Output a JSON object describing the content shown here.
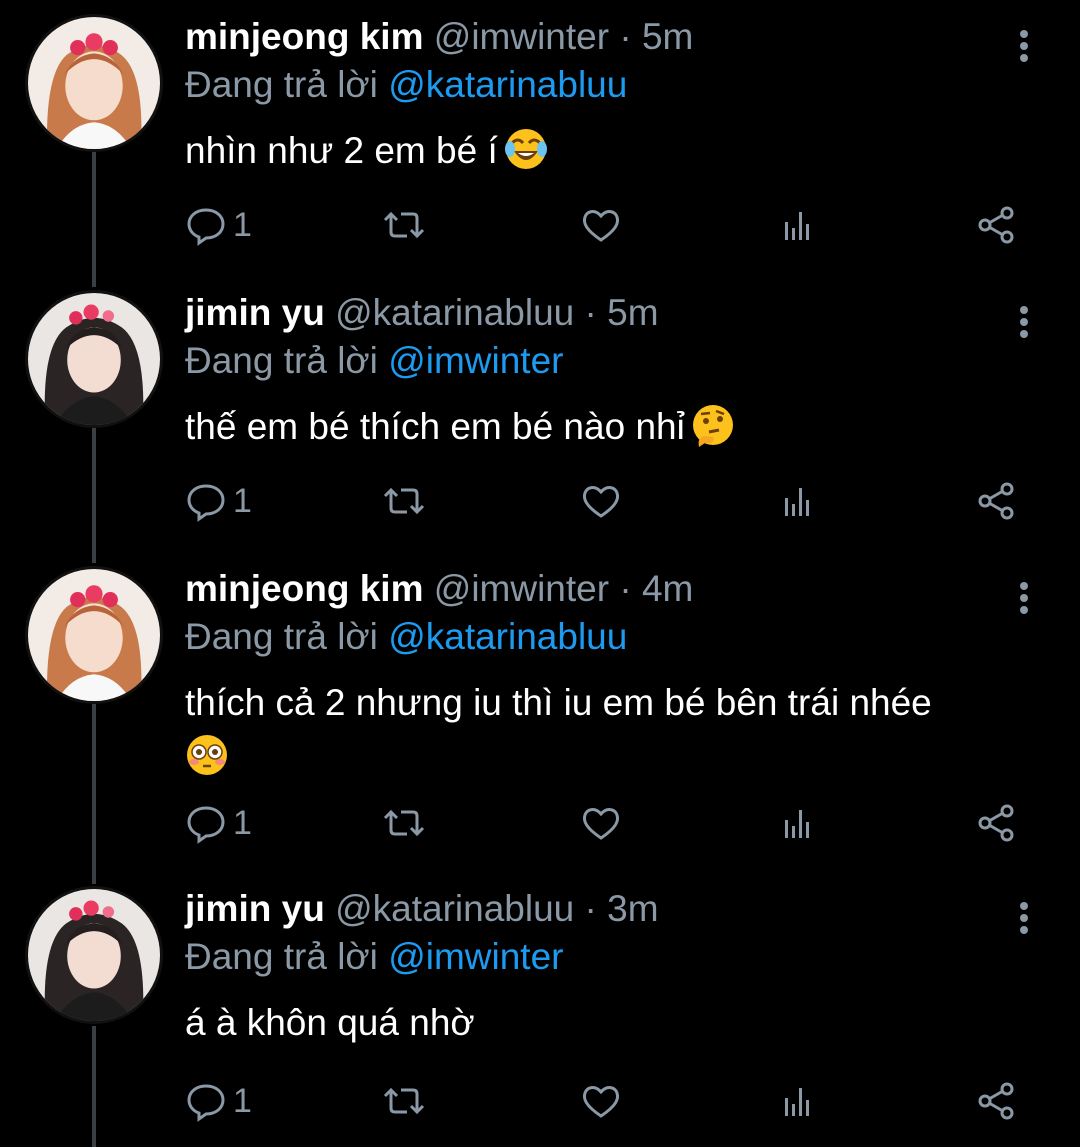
{
  "tweets": [
    {
      "name": "minjeong kim",
      "handle": "@imwinter",
      "dot": "·",
      "time": "5m",
      "replying_prefix": "Đang trả lời",
      "replying_to": "@katarinabluu",
      "text": "nhìn như 2 em bé í",
      "emoji": "face-with-tears-of-joy",
      "reply_count": "1",
      "avatar": "avatar-minjeong"
    },
    {
      "name": "jimin yu",
      "handle": "@katarinabluu",
      "dot": "·",
      "time": "5m",
      "replying_prefix": "Đang trả lời",
      "replying_to": "@imwinter",
      "text": "thế em bé thích em bé nào nhỉ",
      "emoji": "thinking-face",
      "reply_count": "1",
      "avatar": "avatar-jimin"
    },
    {
      "name": "minjeong kim",
      "handle": "@imwinter",
      "dot": "·",
      "time": "4m",
      "replying_prefix": "Đang trả lời",
      "replying_to": "@katarinabluu",
      "text": "thích cả 2 nhưng iu thì iu em bé bên trái nhée",
      "emoji": "flushed-face",
      "reply_count": "1",
      "avatar": "avatar-minjeong"
    },
    {
      "name": "jimin yu",
      "handle": "@katarinabluu",
      "dot": "·",
      "time": "3m",
      "replying_prefix": "Đang trả lời",
      "replying_to": "@imwinter",
      "text": "á à khôn quá nhờ",
      "emoji": "",
      "reply_count": "1",
      "avatar": "avatar-jimin"
    }
  ],
  "icons": {
    "reply": "reply-icon",
    "retweet": "retweet-icon",
    "like": "like-icon",
    "analytics": "analytics-icon",
    "share": "share-icon",
    "more": "more-vertical-icon"
  },
  "colors": {
    "background": "#000000",
    "text": "#ffffff",
    "secondary": "#8b98a5",
    "accent": "#1d9bf0",
    "thread_line": "#3a3f44"
  }
}
